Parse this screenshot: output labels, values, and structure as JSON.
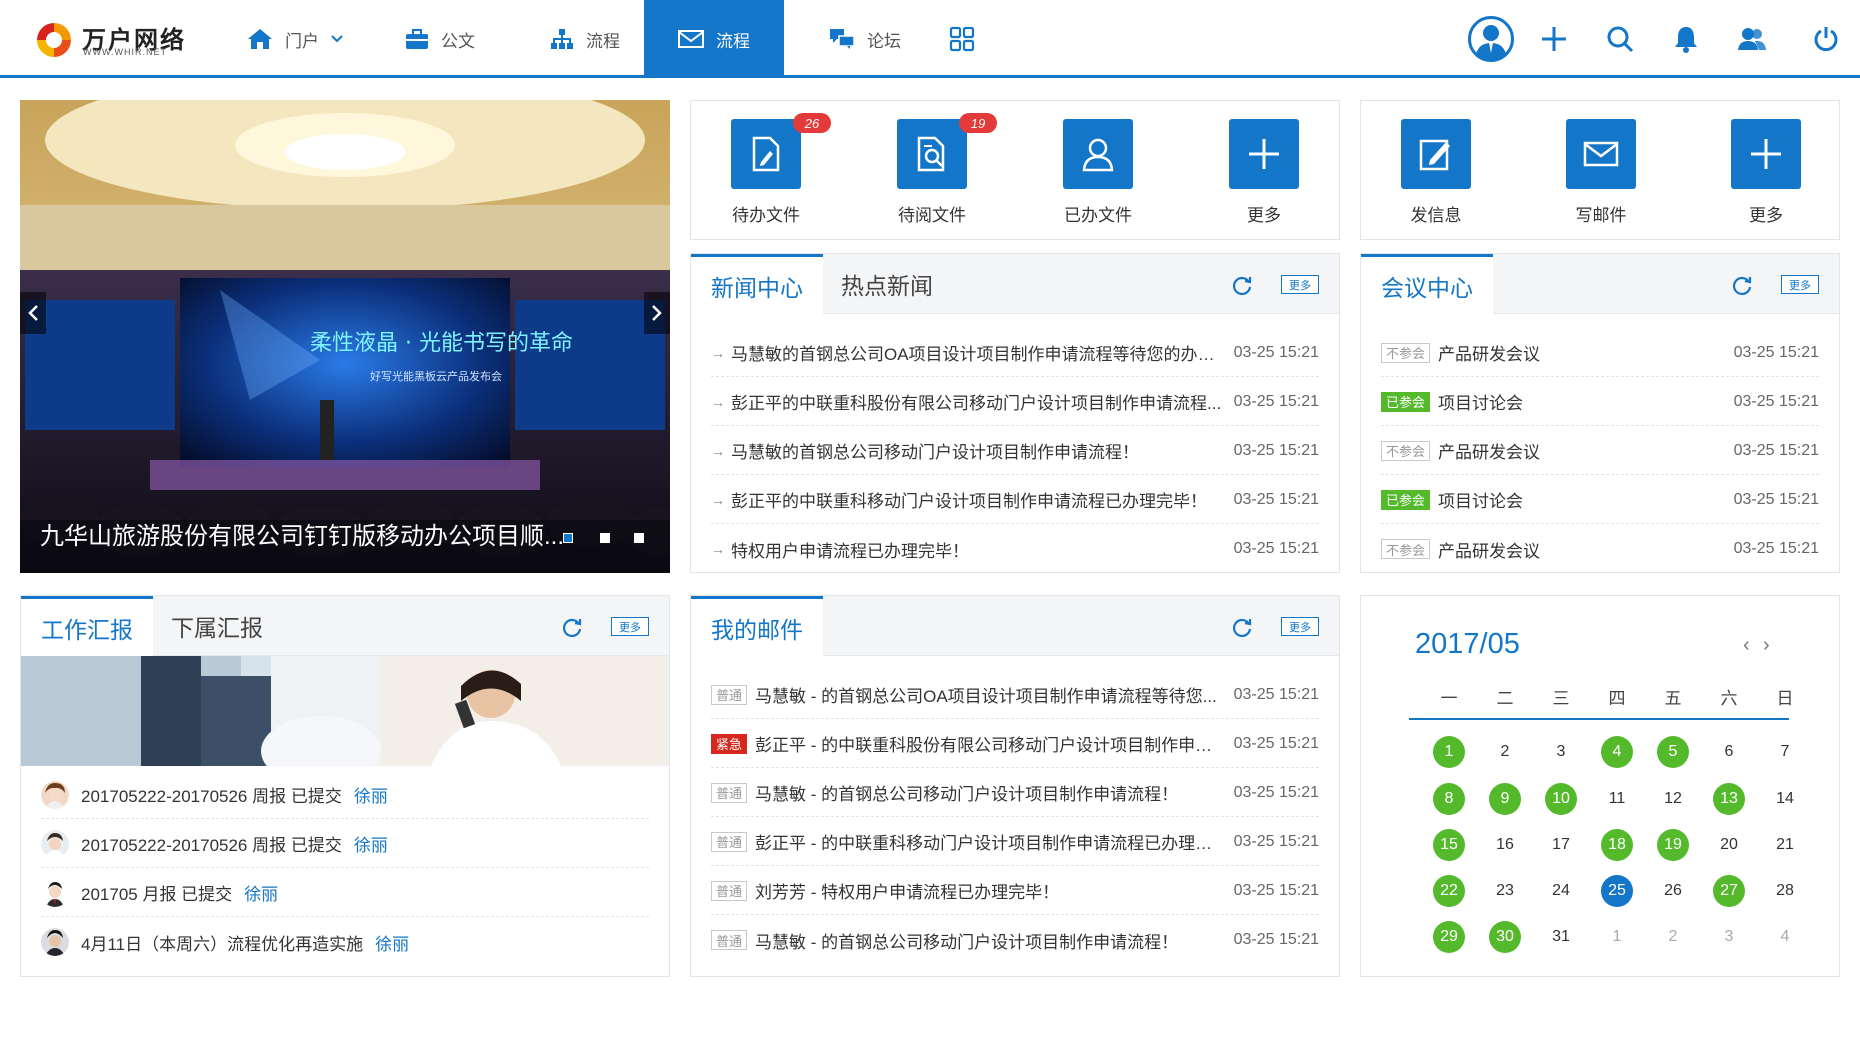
{
  "brand": {
    "name": "万户网络",
    "url": "WWW.WHIR.NET",
    "colors": {
      "primary": "#1476c8",
      "green": "#55b92c",
      "red": "#e43a3a"
    }
  },
  "nav": {
    "items": [
      {
        "label": "门户",
        "icon": "home-icon",
        "has_dropdown": true
      },
      {
        "label": "公文",
        "icon": "briefcase-icon"
      },
      {
        "label": "流程",
        "icon": "org-chart-icon"
      },
      {
        "label": "流程",
        "icon": "mail-icon",
        "active": true
      },
      {
        "label": "论坛",
        "icon": "forum-icon"
      },
      {
        "label": "",
        "icon": "grid-apps-icon"
      }
    ]
  },
  "top_actions": [
    "user-avatar-icon",
    "plus-icon",
    "search-icon",
    "bell-icon",
    "contacts-icon",
    "power-icon"
  ],
  "carousel": {
    "caption": "九华山旅游股份有限公司钉钉版移动办公项目顺...",
    "screen_title": "柔性液晶 · 光能书写的革命",
    "screen_sub": "好写光能黑板云产品发布会",
    "slides": 3,
    "active_slide": 1
  },
  "tiles_left": [
    {
      "label": "待办文件",
      "badge": "26",
      "icon": "pending-doc-icon"
    },
    {
      "label": "待阅文件",
      "badge": "19",
      "icon": "read-doc-icon"
    },
    {
      "label": "已办文件",
      "badge": "",
      "icon": "done-user-icon"
    },
    {
      "label": "更多",
      "badge": "",
      "icon": "plus-icon"
    }
  ],
  "tiles_right": [
    {
      "label": "发信息",
      "icon": "edit-message-icon"
    },
    {
      "label": "写邮件",
      "icon": "envelope-icon"
    },
    {
      "label": "更多",
      "icon": "plus-icon"
    }
  ],
  "news": {
    "tabs": [
      "新闻中心",
      "热点新闻"
    ],
    "more": "更多",
    "items": [
      {
        "text": "马慧敏的首钢总公司OA项目设计项目制作申请流程等待您的办理！",
        "time": "03-25 15:21"
      },
      {
        "text": "彭正平的中联重科股份有限公司移动门户设计项目制作申请流程...",
        "time": "03-25 15:21"
      },
      {
        "text": "马慧敏的首钢总公司移动门户设计项目制作申请流程！",
        "time": "03-25 15:21"
      },
      {
        "text": "彭正平的中联重科移动门户设计项目制作申请流程已办理完毕！",
        "time": "03-25 15:21"
      },
      {
        "text": "特权用户申请流程已办理完毕！",
        "time": "03-25 15:21"
      }
    ]
  },
  "meeting": {
    "tabs": [
      "会议中心"
    ],
    "more": "更多",
    "items": [
      {
        "tag": "不参会",
        "status": "gray",
        "text": "产品研发会议",
        "time": "03-25 15:21"
      },
      {
        "tag": "已参会",
        "status": "green",
        "text": "项目讨论会",
        "time": "03-25 15:21"
      },
      {
        "tag": "不参会",
        "status": "gray",
        "text": "产品研发会议",
        "time": "03-25 15:21"
      },
      {
        "tag": "已参会",
        "status": "green",
        "text": "项目讨论会",
        "time": "03-25 15:21"
      },
      {
        "tag": "不参会",
        "status": "gray",
        "text": "产品研发会议",
        "time": "03-25 15:21"
      }
    ]
  },
  "work": {
    "tabs": [
      "工作汇报",
      "下属汇报"
    ],
    "more": "更多",
    "items": [
      {
        "text": "201705222-20170526  周报  已提交",
        "user": "徐丽"
      },
      {
        "text": "201705222-20170526  周报  已提交",
        "user": "徐丽"
      },
      {
        "text": "201705  月报  已提交",
        "user": "徐丽"
      },
      {
        "text": "4月11日（本周六）流程优化再造实施",
        "user": "徐丽"
      }
    ]
  },
  "mail": {
    "tabs": [
      "我的邮件"
    ],
    "more": "更多",
    "items": [
      {
        "tag": "普通",
        "status": "gray",
        "text": "马慧敏 - 的首钢总公司OA项目设计项目制作申请流程等待您...",
        "time": "03-25 15:21"
      },
      {
        "tag": "紧急",
        "status": "red",
        "text": "彭正平 - 的中联重科股份有限公司移动门户设计项目制作申请...",
        "time": "03-25 15:21"
      },
      {
        "tag": "普通",
        "status": "gray",
        "text": "马慧敏 - 的首钢总公司移动门户设计项目制作申请流程！",
        "time": "03-25 15:21"
      },
      {
        "tag": "普通",
        "status": "gray",
        "text": "彭正平 - 的中联重科移动门户设计项目制作申请流程已办理完...",
        "time": "03-25 15:21"
      },
      {
        "tag": "普通",
        "status": "gray",
        "text": "刘芳芳 - 特权用户申请流程已办理完毕！",
        "time": "03-25 15:21"
      },
      {
        "tag": "普通",
        "status": "gray",
        "text": "马慧敏 - 的首钢总公司移动门户设计项目制作申请流程！",
        "time": "03-25 15:21"
      }
    ]
  },
  "calendar": {
    "title": "2017/05",
    "weekdays": [
      "一",
      "二",
      "三",
      "四",
      "五",
      "六",
      "日"
    ],
    "days": [
      {
        "n": "1",
        "s": "green"
      },
      {
        "n": "2",
        "s": ""
      },
      {
        "n": "3",
        "s": ""
      },
      {
        "n": "4",
        "s": "green"
      },
      {
        "n": "5",
        "s": "green"
      },
      {
        "n": "6",
        "s": ""
      },
      {
        "n": "7",
        "s": ""
      },
      {
        "n": "8",
        "s": "green"
      },
      {
        "n": "9",
        "s": "green"
      },
      {
        "n": "10",
        "s": "green"
      },
      {
        "n": "11",
        "s": ""
      },
      {
        "n": "12",
        "s": ""
      },
      {
        "n": "13",
        "s": "green"
      },
      {
        "n": "14",
        "s": ""
      },
      {
        "n": "15",
        "s": "green"
      },
      {
        "n": "16",
        "s": ""
      },
      {
        "n": "17",
        "s": ""
      },
      {
        "n": "18",
        "s": "green"
      },
      {
        "n": "19",
        "s": "green"
      },
      {
        "n": "20",
        "s": ""
      },
      {
        "n": "21",
        "s": ""
      },
      {
        "n": "22",
        "s": "green"
      },
      {
        "n": "23",
        "s": ""
      },
      {
        "n": "24",
        "s": ""
      },
      {
        "n": "25",
        "s": "blue"
      },
      {
        "n": "26",
        "s": ""
      },
      {
        "n": "27",
        "s": "green"
      },
      {
        "n": "28",
        "s": ""
      },
      {
        "n": "29",
        "s": "green"
      },
      {
        "n": "30",
        "s": "green"
      },
      {
        "n": "31",
        "s": ""
      },
      {
        "n": "1",
        "s": "muted"
      },
      {
        "n": "2",
        "s": "muted"
      },
      {
        "n": "3",
        "s": "muted"
      },
      {
        "n": "4",
        "s": "muted"
      }
    ]
  }
}
